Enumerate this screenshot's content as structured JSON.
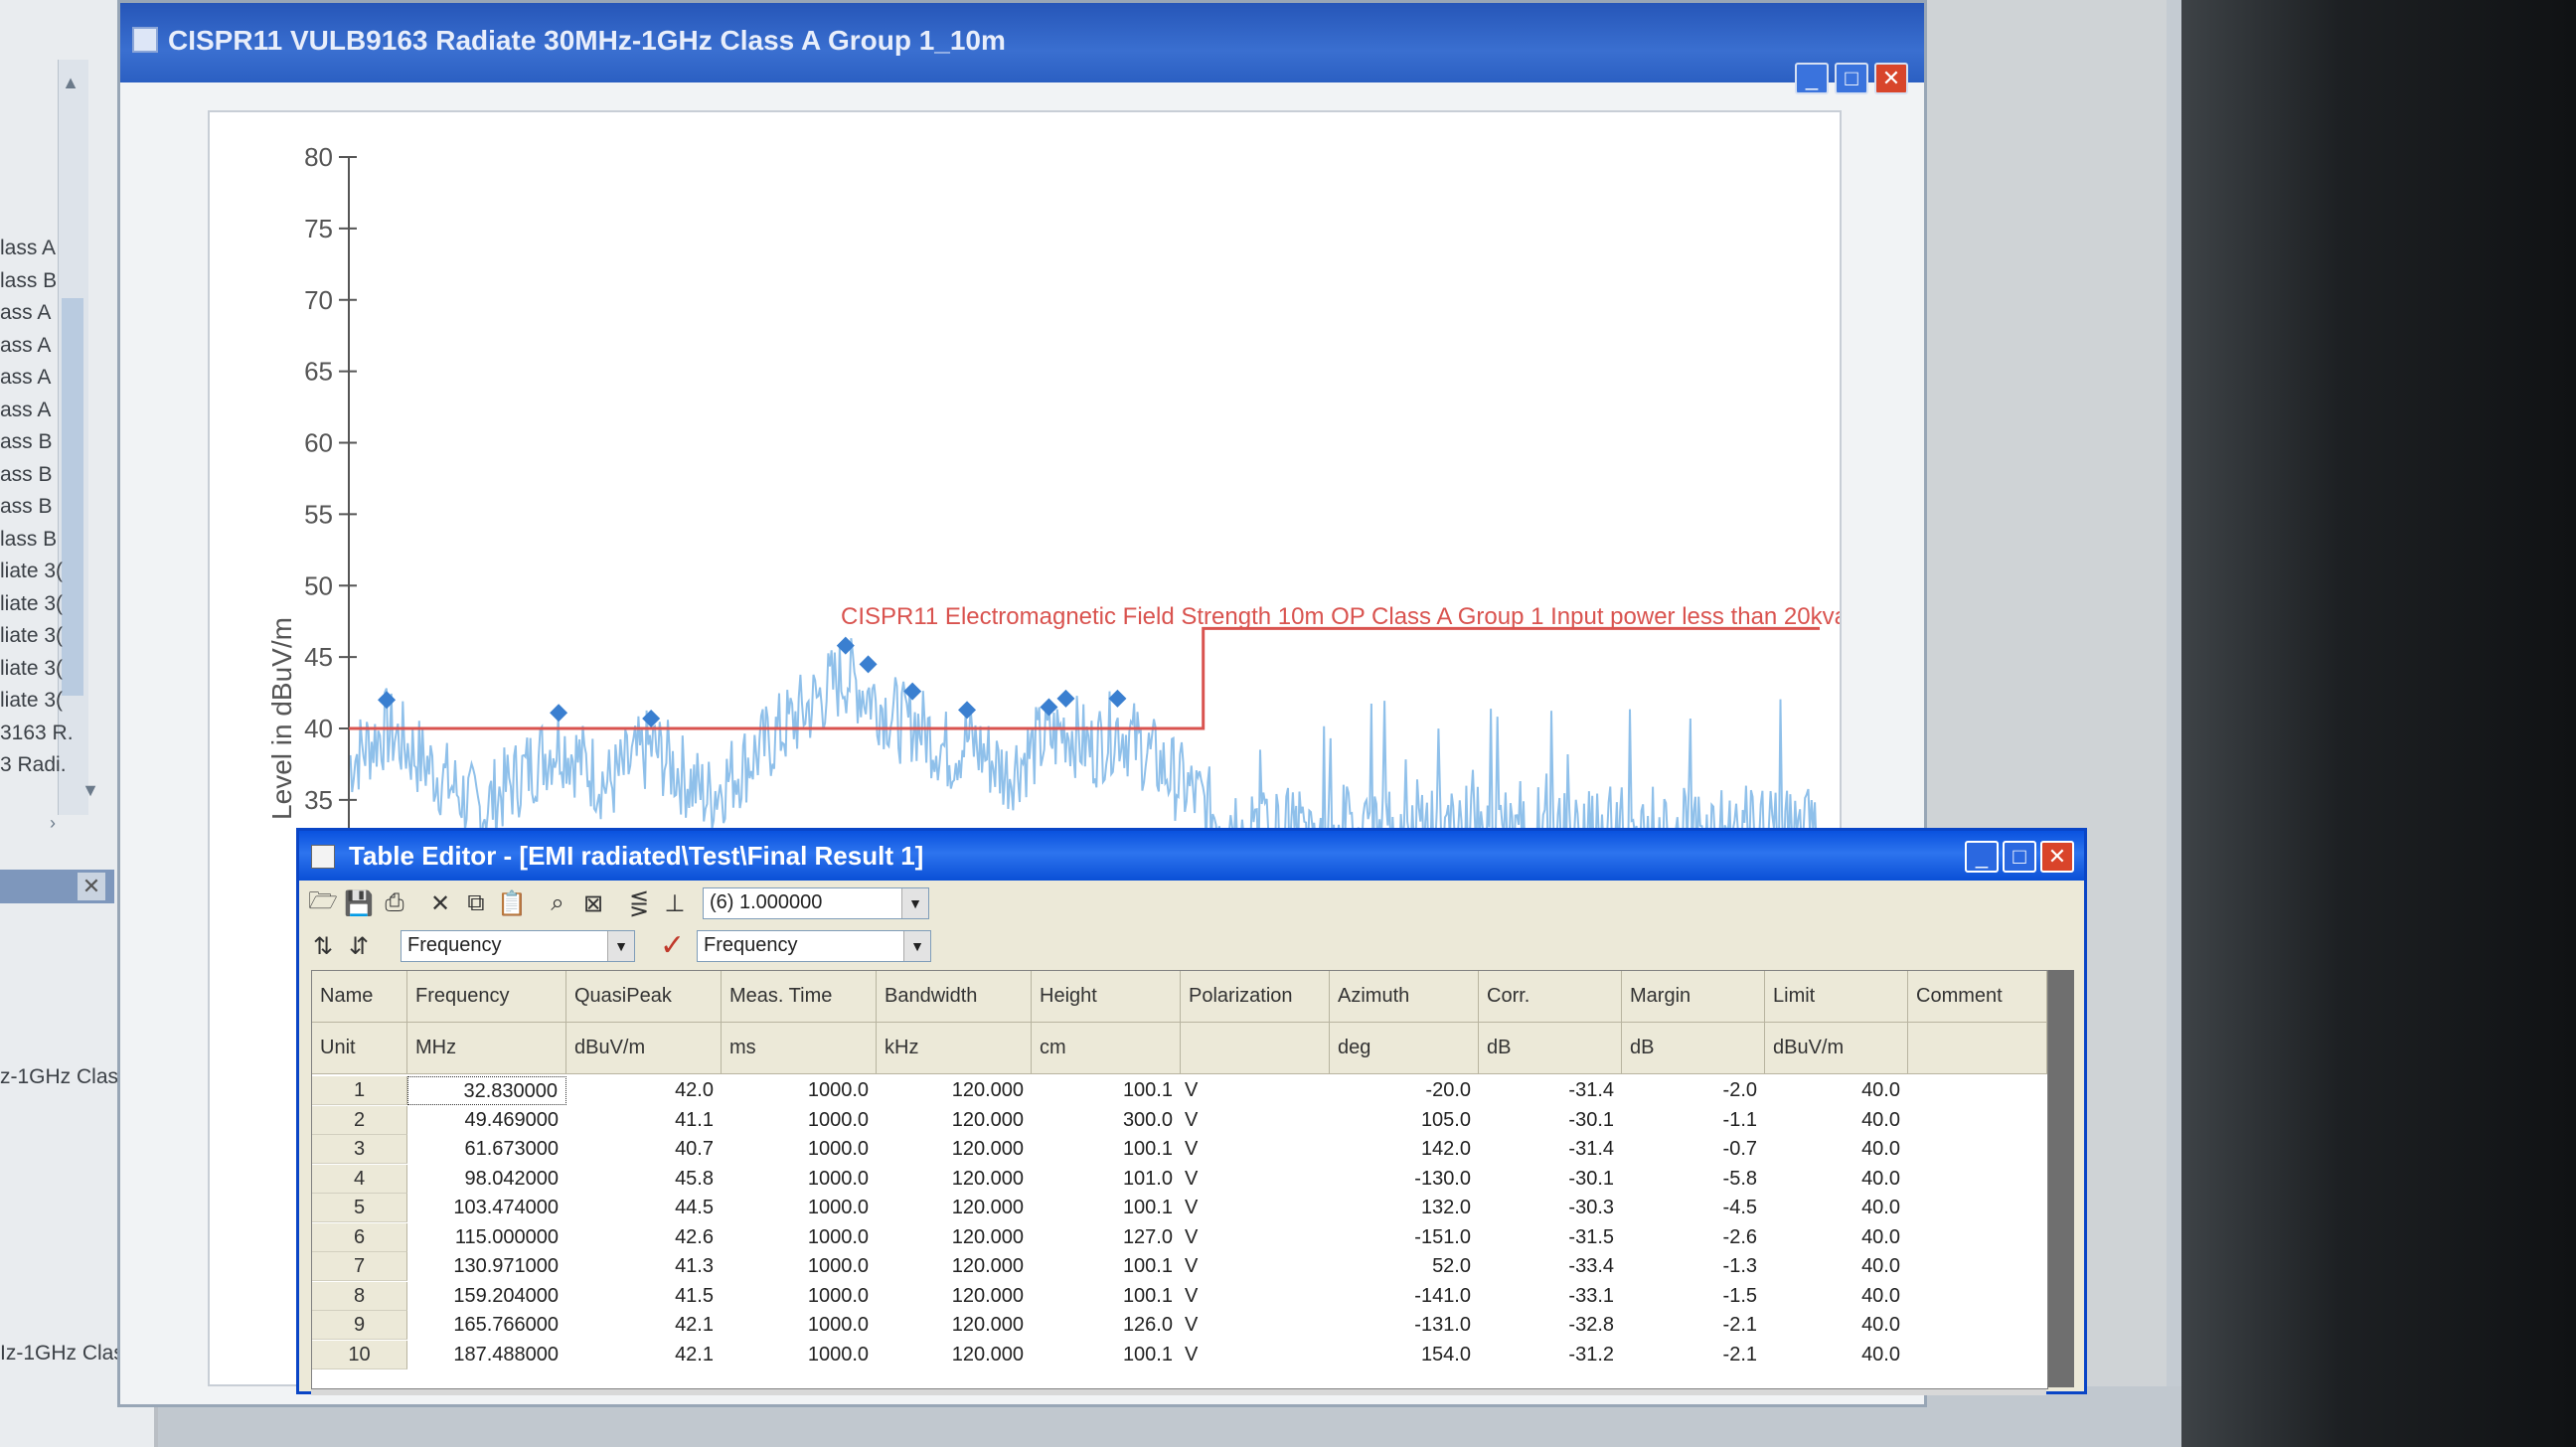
{
  "left_panel": {
    "items": [
      "lass A",
      "lass B",
      "ass A",
      "ass A",
      "ass A",
      "ass A",
      "ass B",
      "ass B",
      "ass B",
      "lass B",
      "liate 3(",
      "liate 3(",
      "liate 3(",
      "liate 3(",
      "liate 3(",
      "3163 R.",
      "3 Radi."
    ],
    "bottom_items": [
      "z-1GHz Clas",
      "Iz-1GHz Clas"
    ]
  },
  "chart_window": {
    "title": "CISPR11 VULB9163 Radiate 30MHz-1GHz Class A Group 1_10m",
    "controls": {
      "minimize": "_",
      "maximize": "□",
      "close": "✕"
    }
  },
  "chart_data": {
    "type": "line",
    "ylabel": "Level in dBuV/m",
    "y_ticks": [
      35,
      40,
      45,
      50,
      55,
      60,
      65,
      70,
      75,
      80
    ],
    "ylim": [
      30,
      80
    ],
    "x_scale": "log",
    "xlim": [
      30,
      1000
    ],
    "limit_line": {
      "label": "CISPR11 Electromagnetic Field Strength 10m OP Class A Group 1 Input power less than 20kva",
      "segments": [
        {
          "x": [
            30,
            230
          ],
          "y": 40.0
        },
        {
          "x": [
            230,
            1000
          ],
          "y": 47.0
        }
      ],
      "color": "#d9534f"
    },
    "final_points": {
      "x": [
        32.83,
        49.469,
        61.673,
        98.042,
        103.474,
        115.0,
        130.971,
        159.204,
        165.766,
        187.488
      ],
      "y": [
        42.0,
        41.1,
        40.7,
        45.8,
        44.5,
        42.6,
        41.3,
        41.5,
        42.1,
        42.1
      ],
      "color": "#3a7fd0"
    },
    "spectrum_color": "#8fc0ea"
  },
  "table_window": {
    "title": "Table Editor - [EMI radiated\\Test\\Final Result 1]",
    "controls": {
      "minimize": "_",
      "maximize": "□",
      "close": "✕"
    },
    "toolbar": {
      "combo_value": "(6) 1.000000",
      "sort_field": "Frequency",
      "filter_field": "Frequency"
    },
    "columns": [
      "Name",
      "Frequency",
      "QuasiPeak",
      "Meas. Time",
      "Bandwidth",
      "Height",
      "Polarization",
      "Azimuth",
      "Corr.",
      "Margin",
      "Limit",
      "Comment"
    ],
    "units": [
      "Unit",
      "MHz",
      "dBuV/m",
      "ms",
      "kHz",
      "cm",
      "",
      "deg",
      "dB",
      "dB",
      "dBuV/m",
      ""
    ],
    "rows": [
      [
        "1",
        "32.830000",
        "42.0",
        "1000.0",
        "120.000",
        "100.1",
        "V",
        "-20.0",
        "-31.4",
        "-2.0",
        "40.0",
        ""
      ],
      [
        "2",
        "49.469000",
        "41.1",
        "1000.0",
        "120.000",
        "300.0",
        "V",
        "105.0",
        "-30.1",
        "-1.1",
        "40.0",
        ""
      ],
      [
        "3",
        "61.673000",
        "40.7",
        "1000.0",
        "120.000",
        "100.1",
        "V",
        "142.0",
        "-31.4",
        "-0.7",
        "40.0",
        ""
      ],
      [
        "4",
        "98.042000",
        "45.8",
        "1000.0",
        "120.000",
        "101.0",
        "V",
        "-130.0",
        "-30.1",
        "-5.8",
        "40.0",
        ""
      ],
      [
        "5",
        "103.474000",
        "44.5",
        "1000.0",
        "120.000",
        "100.1",
        "V",
        "132.0",
        "-30.3",
        "-4.5",
        "40.0",
        ""
      ],
      [
        "6",
        "115.000000",
        "42.6",
        "1000.0",
        "120.000",
        "127.0",
        "V",
        "-151.0",
        "-31.5",
        "-2.6",
        "40.0",
        ""
      ],
      [
        "7",
        "130.971000",
        "41.3",
        "1000.0",
        "120.000",
        "100.1",
        "V",
        "52.0",
        "-33.4",
        "-1.3",
        "40.0",
        ""
      ],
      [
        "8",
        "159.204000",
        "41.5",
        "1000.0",
        "120.000",
        "100.1",
        "V",
        "-141.0",
        "-33.1",
        "-1.5",
        "40.0",
        ""
      ],
      [
        "9",
        "165.766000",
        "42.1",
        "1000.0",
        "120.000",
        "126.0",
        "V",
        "-131.0",
        "-32.8",
        "-2.1",
        "40.0",
        ""
      ],
      [
        "10",
        "187.488000",
        "42.1",
        "1000.0",
        "120.000",
        "100.1",
        "V",
        "154.0",
        "-31.2",
        "-2.1",
        "40.0",
        ""
      ]
    ]
  }
}
